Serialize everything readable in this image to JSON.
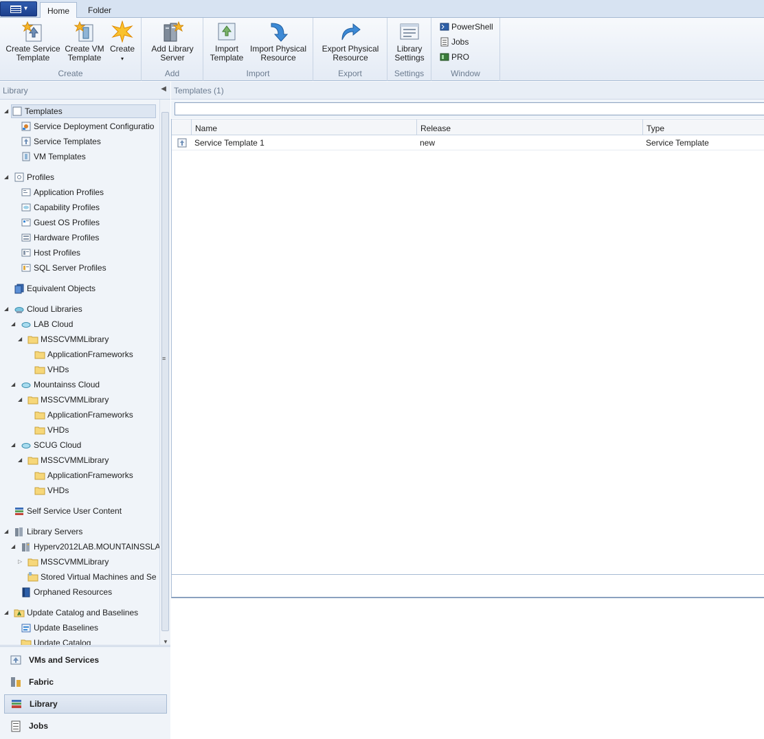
{
  "tabs": {
    "home": "Home",
    "folder": "Folder"
  },
  "ribbon": {
    "create_service_template": "Create Service\nTemplate",
    "create_vm_template": "Create VM\nTemplate",
    "create": "Create",
    "add_library_server": "Add Library\nServer",
    "import_template": "Import\nTemplate",
    "import_physical_resource": "Import Physical\nResource",
    "export_physical_resource": "Export Physical\nResource",
    "library_settings": "Library\nSettings",
    "powershell": "PowerShell",
    "jobs": "Jobs",
    "pro": "PRO",
    "groups": {
      "create": "Create",
      "add": "Add",
      "import": "Import",
      "export": "Export",
      "settings": "Settings",
      "window": "Window"
    }
  },
  "left": {
    "header": "Library",
    "tree": {
      "templates": "Templates",
      "service_deployment": "Service Deployment Configuratio",
      "service_templates": "Service Templates",
      "vm_templates": "VM Templates",
      "profiles": "Profiles",
      "application_profiles": "Application Profiles",
      "capability_profiles": "Capability Profiles",
      "guest_os_profiles": "Guest OS Profiles",
      "hardware_profiles": "Hardware Profiles",
      "host_profiles": "Host Profiles",
      "sql_server_profiles": "SQL Server Profiles",
      "equivalent_objects": "Equivalent Objects",
      "cloud_libraries": "Cloud Libraries",
      "lab_cloud": "LAB Cloud",
      "mountainss_cloud": "Mountainss Cloud",
      "scug_cloud": "SCUG Cloud",
      "msscvmm_library": "MSSCVMMLibrary",
      "application_frameworks": "ApplicationFrameworks",
      "vhds": "VHDs",
      "self_service": "Self Service User Content",
      "library_servers": "Library Servers",
      "hyperv_server": "Hyperv2012LAB.MOUNTAINSSLA",
      "stored_vms": "Stored Virtual Machines and Se",
      "orphaned_resources": "Orphaned Resources",
      "update_catalog": "Update Catalog and Baselines",
      "update_baselines": "Update Baselines",
      "update_catalog_item": "Update Catalog"
    },
    "wunderbar": {
      "vms": "VMs and Services",
      "fabric": "Fabric",
      "library": "Library",
      "jobs": "Jobs"
    }
  },
  "main": {
    "header": "Templates (1)",
    "search": {
      "value": "",
      "placeholder": ""
    },
    "columns": {
      "name": "Name",
      "release": "Release",
      "type": "Type"
    },
    "rows": [
      {
        "name": "Service Template 1",
        "release": "new",
        "type": "Service Template"
      }
    ]
  },
  "colors": {
    "accent": "#1c3f8c",
    "ribbon_bg": "#e4ebf5",
    "pane_bg": "#f0f4f9",
    "border": "#a6bad3"
  }
}
